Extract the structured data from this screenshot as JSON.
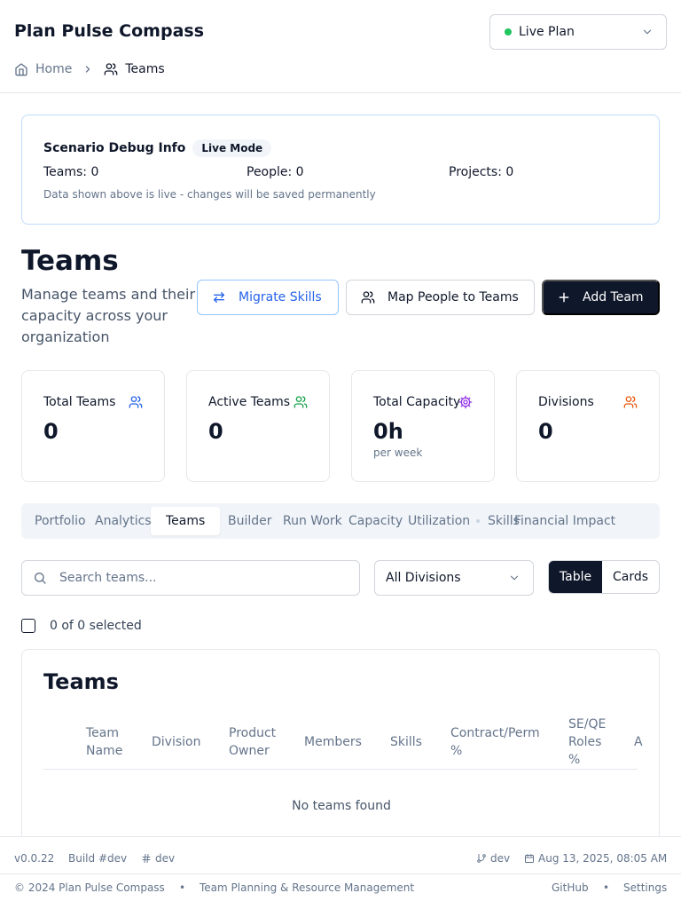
{
  "header": {
    "app_title": "Plan Pulse Compass",
    "plan_select": {
      "value": "Live Plan",
      "status_color": "#22c55e"
    }
  },
  "breadcrumb": {
    "home": "Home",
    "current": "Teams"
  },
  "debug": {
    "title": "Scenario Debug Info",
    "badge": "Live Mode",
    "teams": "Teams: 0",
    "people": "People: 0",
    "projects": "Projects: 0",
    "note": "Data shown above is live - changes will be saved permanently"
  },
  "page": {
    "title": "Teams",
    "description": "Manage teams and their capacity across your organization",
    "migrate_label": "Migrate Skills",
    "map_label": "Map People to Teams",
    "add_label": "Add Team"
  },
  "stats": {
    "total_teams": {
      "label": "Total Teams",
      "value": "0"
    },
    "active_teams": {
      "label": "Active Teams",
      "value": "0"
    },
    "total_capacity": {
      "label": "Total Capacity",
      "value": "0h",
      "sub": "per week"
    },
    "divisions": {
      "label": "Divisions",
      "value": "0"
    }
  },
  "tabs": {
    "portfolio": "Portfolio",
    "analytics": "Analytics",
    "teams": "Teams",
    "builder": "Builder",
    "run_work": "Run Work",
    "capacity": "Capacity",
    "utilization": "Utilization",
    "skills": "Skills",
    "financial_impact": "Financial Impact"
  },
  "filters": {
    "search_placeholder": "Search teams...",
    "division_value": "All Divisions",
    "view_table": "Table",
    "view_cards": "Cards",
    "selected_text": "0 of 0 selected"
  },
  "table": {
    "title": "Teams",
    "columns": {
      "team_name": "Team Name",
      "division": "Division",
      "product_owner": "Product Owner",
      "members": "Members",
      "skills": "Skills",
      "contract_perm": "Contract/Perm %",
      "se_qe": "SE/QE Roles %",
      "actions": "A"
    },
    "empty": "No teams found"
  },
  "footer": {
    "version": "v0.0.22",
    "build": "Build #dev",
    "hash": "dev",
    "branch": "dev",
    "date": "Aug 13, 2025, 08:05 AM",
    "copyright": "© 2024 Plan Pulse Compass",
    "sep": "•",
    "tagline": "Team Planning & Resource Management",
    "github": "GitHub",
    "settings": "Settings"
  },
  "colors": {
    "primary": "#0f172a",
    "accent_blue": "#2563eb",
    "green": "#22c55e",
    "purple": "#9333ea",
    "orange": "#ea580c"
  }
}
